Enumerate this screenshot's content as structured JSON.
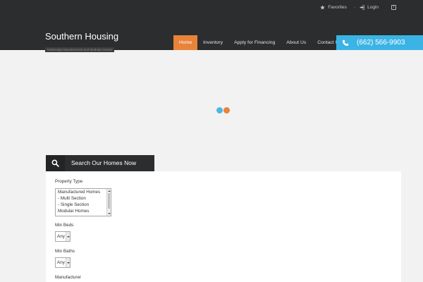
{
  "topbar": {
    "favorites_label": "Favorites",
    "login_label": "Login",
    "separator": "-"
  },
  "brand": {
    "title": "Southern Housing",
    "tagline": "Mississippi Manufactured and Modular Homes"
  },
  "nav": {
    "items": [
      {
        "label": "Home",
        "active": true
      },
      {
        "label": "Inventory"
      },
      {
        "label": "Apply for Financing"
      },
      {
        "label": "About Us"
      },
      {
        "label": "Contact Us"
      }
    ]
  },
  "phone": {
    "number": "(662) 566-9903"
  },
  "loader": {
    "colors": [
      "#4bb8e6",
      "#e8833a"
    ]
  },
  "search": {
    "heading": "Search Our Homes Now",
    "property_type_label": "Property Type",
    "property_type_options": [
      "Manufactured Homes",
      " - Multi Section",
      " - Single Section",
      "Modular Homes"
    ],
    "min_beds_label": "Min Beds",
    "min_beds_value": "Any",
    "min_baths_label": "Min Baths",
    "min_baths_value": "Any",
    "manufacturer_label": "Manufacturer"
  },
  "colors": {
    "header_bg": "#2b2d2e",
    "accent_orange": "#e8833a",
    "accent_blue": "#3bb4e5"
  },
  "icons": {
    "favorites": "star-icon",
    "login": "sign-in-icon",
    "social": "facebook-icon",
    "phone": "phone-icon",
    "search": "search-icon"
  }
}
